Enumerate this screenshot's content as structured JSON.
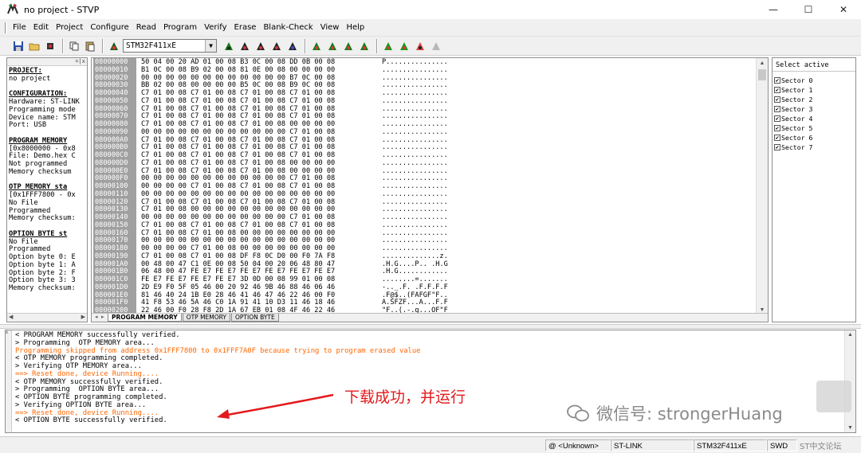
{
  "window": {
    "title": "no project - STVP",
    "controls": [
      "—",
      "☐",
      "✕"
    ]
  },
  "menu": [
    "File",
    "Edit",
    "Project",
    "Configure",
    "Read",
    "Program",
    "Verify",
    "Erase",
    "Blank-Check",
    "View",
    "Help"
  ],
  "toolbar": {
    "device": "STM32F411xE"
  },
  "left_panel": {
    "lines": [
      {
        "t": "PROJECT:",
        "h": true
      },
      {
        "t": "no project",
        "h": false
      },
      {
        "t": "",
        "h": false
      },
      {
        "t": "CONFIGURATION:",
        "h": true
      },
      {
        "t": "Hardware: ST-LINK",
        "h": false
      },
      {
        "t": "Programming mode",
        "h": false
      },
      {
        "t": "Device name: STM",
        "h": false
      },
      {
        "t": "Port: USB",
        "h": false
      },
      {
        "t": "",
        "h": false
      },
      {
        "t": "PROGRAM MEMORY",
        "h": true
      },
      {
        "t": "[0x8000000 - 0x8",
        "h": false
      },
      {
        "t": "File: Demo.hex C",
        "h": false
      },
      {
        "t": "Not programmed",
        "h": false
      },
      {
        "t": "Memory checksum",
        "h": false
      },
      {
        "t": "",
        "h": false
      },
      {
        "t": "OTP MEMORY sta",
        "h": true
      },
      {
        "t": "[0x1FFF7800 - 0x",
        "h": false
      },
      {
        "t": "No File",
        "h": false
      },
      {
        "t": "Programmed",
        "h": false
      },
      {
        "t": "Memory checksum:",
        "h": false
      },
      {
        "t": "",
        "h": false
      },
      {
        "t": "OPTION BYTE st",
        "h": true
      },
      {
        "t": "No File",
        "h": false
      },
      {
        "t": "Programmed",
        "h": false
      },
      {
        "t": "Option byte 0: E",
        "h": false
      },
      {
        "t": "Option byte 1: A",
        "h": false
      },
      {
        "t": "Option byte 2: F",
        "h": false
      },
      {
        "t": "Option byte 3: 3",
        "h": false
      },
      {
        "t": "Memory checksum:",
        "h": false
      }
    ]
  },
  "hex": {
    "rows": [
      {
        "addr": "08000000",
        "bytes": "50 04 00 20 AD 01 00 08 B3 0C 00 08 DD 0B 00 08",
        "ascii": "P..............."
      },
      {
        "addr": "08000010",
        "bytes": "B1 0C 00 08 B9 02 00 08 81 0E 00 08 00 00 00 00",
        "ascii": "................"
      },
      {
        "addr": "08000020",
        "bytes": "00 00 00 00 00 00 00 00 00 00 00 00 B7 0C 00 08",
        "ascii": "................"
      },
      {
        "addr": "08000030",
        "bytes": "BB 02 00 08 00 00 00 00 B5 0C 00 08 B9 0C 00 08",
        "ascii": "................"
      },
      {
        "addr": "08000040",
        "bytes": "C7 01 00 08 C7 01 00 08 C7 01 00 08 C7 01 00 08",
        "ascii": "................"
      },
      {
        "addr": "08000050",
        "bytes": "C7 01 00 08 C7 01 00 08 C7 01 00 08 C7 01 00 08",
        "ascii": "................"
      },
      {
        "addr": "08000060",
        "bytes": "C7 01 00 08 C7 01 00 08 C7 01 00 08 C7 01 00 08",
        "ascii": "................"
      },
      {
        "addr": "08000070",
        "bytes": "C7 01 00 08 C7 01 00 08 C7 01 00 08 C7 01 00 08",
        "ascii": "................"
      },
      {
        "addr": "08000080",
        "bytes": "C7 01 00 08 C7 01 00 08 C7 01 00 08 00 00 00 00",
        "ascii": "................"
      },
      {
        "addr": "08000090",
        "bytes": "00 00 00 00 00 00 00 00 00 00 00 00 C7 01 00 08",
        "ascii": "................"
      },
      {
        "addr": "080000A0",
        "bytes": "C7 01 00 08 C7 01 00 08 C7 01 00 08 C7 01 00 08",
        "ascii": "................"
      },
      {
        "addr": "080000B0",
        "bytes": "C7 01 00 08 C7 01 00 08 C7 01 00 08 C7 01 00 08",
        "ascii": "................"
      },
      {
        "addr": "080000C0",
        "bytes": "C7 01 00 08 C7 01 00 08 C7 01 00 08 C7 01 00 08",
        "ascii": "................"
      },
      {
        "addr": "080000D0",
        "bytes": "C7 01 00 08 C7 01 00 08 C7 01 00 08 00 00 00 00",
        "ascii": "................"
      },
      {
        "addr": "080000E0",
        "bytes": "C7 01 00 08 C7 01 00 08 C7 01 00 08 00 00 00 00",
        "ascii": "................"
      },
      {
        "addr": "080000F0",
        "bytes": "00 00 00 00 00 00 00 00 00 00 00 00 C7 01 00 08",
        "ascii": "................"
      },
      {
        "addr": "08000100",
        "bytes": "00 00 00 00 C7 01 00 08 C7 01 00 08 C7 01 00 08",
        "ascii": "................"
      },
      {
        "addr": "08000110",
        "bytes": "00 00 00 00 00 00 00 00 00 00 00 00 00 00 00 00",
        "ascii": "................"
      },
      {
        "addr": "08000120",
        "bytes": "C7 01 00 08 C7 01 00 08 C7 01 00 08 C7 01 00 08",
        "ascii": "................"
      },
      {
        "addr": "08000130",
        "bytes": "C7 01 00 08 00 00 00 00 00 00 00 00 00 00 00 00",
        "ascii": "................"
      },
      {
        "addr": "08000140",
        "bytes": "00 00 00 00 00 00 00 00 00 00 00 00 C7 01 00 08",
        "ascii": "................"
      },
      {
        "addr": "08000150",
        "bytes": "C7 01 00 08 C7 01 00 08 C7 01 00 08 C7 01 00 08",
        "ascii": "................"
      },
      {
        "addr": "08000160",
        "bytes": "C7 01 00 08 C7 01 00 08 00 00 00 00 00 00 00 00",
        "ascii": "................"
      },
      {
        "addr": "08000170",
        "bytes": "00 00 00 00 00 00 00 00 00 00 00 00 00 00 00 00",
        "ascii": "................"
      },
      {
        "addr": "08000180",
        "bytes": "00 00 00 00 C7 01 00 08 00 00 00 00 00 00 00 00",
        "ascii": "................"
      },
      {
        "addr": "08000190",
        "bytes": "C7 01 00 08 C7 01 00 08 DF F8 0C D0 00 F0 7A F8",
        "ascii": "..............z."
      },
      {
        "addr": "080001A0",
        "bytes": "00 48 00 47 C1 0E 00 08 50 04 00 20 06 48 80 47",
        "ascii": ".H.G....P.. .H.G"
      },
      {
        "addr": "080001B0",
        "bytes": "06 48 00 47 FE E7 FE E7 FE E7 FE E7 FE E7 FE E7",
        "ascii": ".H.G............"
      },
      {
        "addr": "080001C0",
        "bytes": "FE E7 FE E7 FE E7 FE E7 3D 0D 00 08 99 01 00 08",
        "ascii": "........=......."
      },
      {
        "addr": "080001D0",
        "bytes": "2D E9 F0 5F 05 46 00 20 92 46 9B 46 88 46 06 46",
        "ascii": "-.._.F. .F.F.F.F"
      },
      {
        "addr": "080001E0",
        "bytes": "81 46 40 24 1B E0 28 46 41 46 47 46 22 46 00 F0",
        "ascii": ".F@$..(FAFGF\"F.."
      },
      {
        "addr": "080001F0",
        "bytes": "41 F8 53 46 5A 46 C0 1A 91 41 10 D3 11 46 18 46",
        "ascii": "A.SFZF...A...F.F"
      },
      {
        "addr": "08000200",
        "bytes": "22 46 00 F0 28 F8 2D 1A 67 EB 01 08 4F 46 22 46",
        "ascii": "\"F..(.-.g...OF\"F"
      }
    ],
    "tabs": [
      "PROGRAM MEMORY",
      "OTP MEMORY",
      "OPTION BYTE"
    ]
  },
  "sectors": {
    "header": "Select active",
    "items": [
      "Sector 0",
      "Sector 1",
      "Sector 2",
      "Sector 3",
      "Sector 4",
      "Sector 5",
      "Sector 6",
      "Sector 7"
    ]
  },
  "log": {
    "lines": [
      {
        "t": "< PROGRAM MEMORY successfully verified.",
        "err": false
      },
      {
        "t": "> Programming  OTP MEMORY area...",
        "err": false
      },
      {
        "t": "Programming skipped from address 0x1FFF7800 to 0x1FFF7A0F because trying to program erased value",
        "err": true
      },
      {
        "t": "< OTP MEMORY programming completed.",
        "err": false
      },
      {
        "t": "> Verifying OTP MEMORY area...",
        "err": false
      },
      {
        "t": "==> Reset done, device Running....",
        "err": true
      },
      {
        "t": "< OTP MEMORY successfully verified.",
        "err": false
      },
      {
        "t": "> Programming  OPTION BYTE area...",
        "err": false
      },
      {
        "t": "< OPTION BYTE programming completed.",
        "err": false
      },
      {
        "t": "> Verifying OPTION BYTE area...",
        "err": false
      },
      {
        "t": "==> Reset done, device Running....",
        "err": true
      },
      {
        "t": "< OPTION BYTE successfully verified.",
        "err": false
      }
    ]
  },
  "annotation": {
    "text": "下载成功，并运行",
    "color": "#e4191c"
  },
  "watermark": {
    "text": "微信号: strongerHuang",
    "corner": "ST中文论坛"
  },
  "statusbar": {
    "fields": [
      "@ <Unknown>",
      "ST-LINK",
      "STM32F411xE",
      "SWD"
    ]
  }
}
